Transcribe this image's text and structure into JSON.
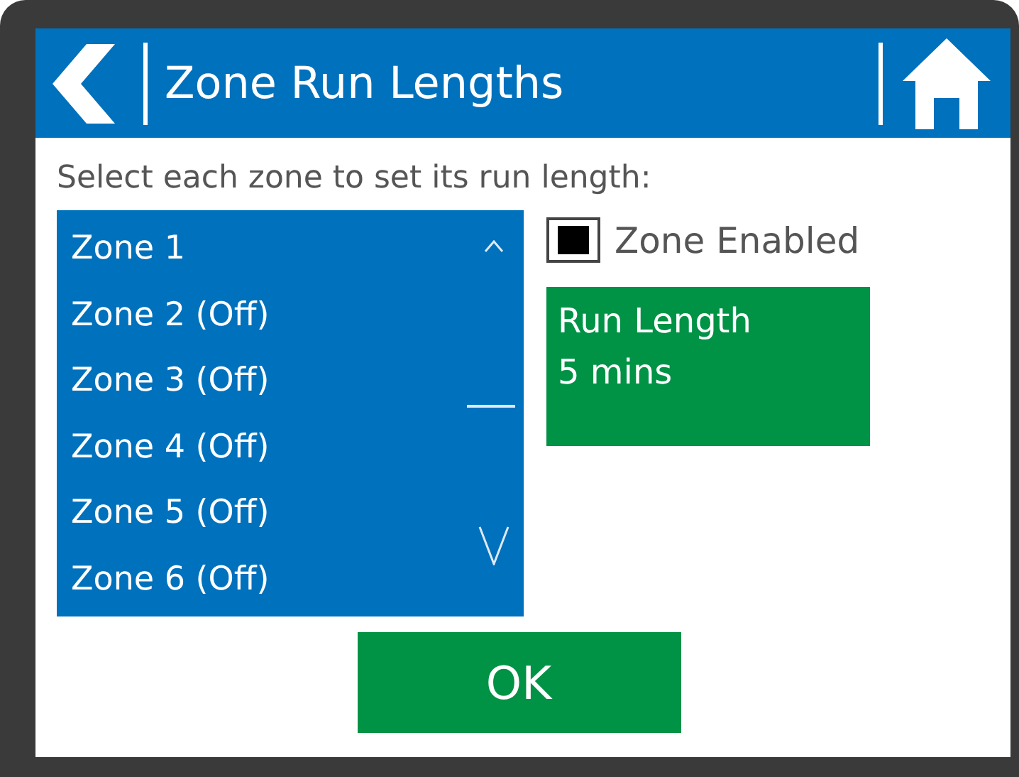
{
  "header": {
    "title": "Zone Run Lengths"
  },
  "instruction": "Select each zone to set its run length:",
  "zones": [
    {
      "label": "Zone 1"
    },
    {
      "label": "Zone 2 (Off)"
    },
    {
      "label": "Zone 3 (Off)"
    },
    {
      "label": "Zone 4 (Off)"
    },
    {
      "label": "Zone 5 (Off)"
    },
    {
      "label": "Zone 6 (Off)"
    }
  ],
  "zone_enabled": {
    "label": "Zone Enabled",
    "checked": true
  },
  "run_length": {
    "label": "Run Length",
    "value": "5 mins"
  },
  "ok_button": "OK"
}
